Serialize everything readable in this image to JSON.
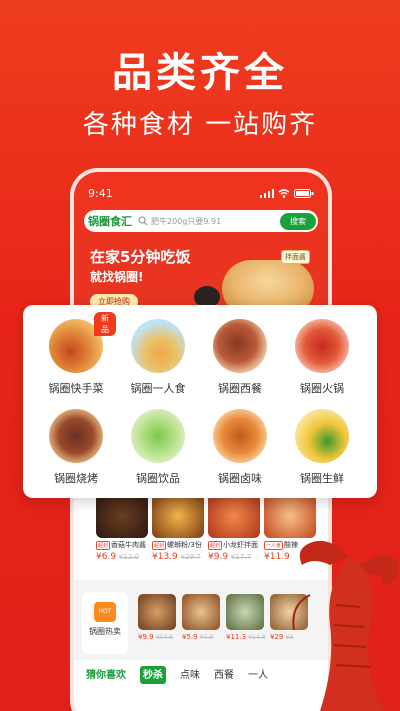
{
  "headline": "品类齐全",
  "subline": "各种食材 一站购齐",
  "phone": {
    "time": "9:41",
    "logo": "锅圈食汇",
    "search_placeholder": "肥牛200g只要9.91",
    "search_button": "搜索",
    "banner": {
      "title": "在家5分钟吃饭",
      "subtitle": "就找锅圈!",
      "button": "立即抢购",
      "tag": "拌面酱"
    },
    "products": [
      {
        "tag": "超划",
        "name": "香菇牛肉酱",
        "price": "¥6.9",
        "old": "¥12.0"
      },
      {
        "tag": "超划",
        "name": "螺蛳粉/3份",
        "price": "¥13.9",
        "old": "¥29.7"
      },
      {
        "tag": "超划",
        "name": "小龙虾拌面",
        "price": "¥9.9",
        "old": "¥17.7"
      },
      {
        "tag": "一人食",
        "name": "酸辣",
        "price": "¥11.9",
        "old": ""
      }
    ],
    "hot": {
      "label": "锅圈热卖",
      "icon_text": "HOT"
    },
    "mini_products": [
      {
        "price": "¥9.9",
        "old": "¥14.6"
      },
      {
        "price": "¥5.9",
        "old": "¥7.9"
      },
      {
        "price": "¥11.3",
        "old": "¥14.8"
      },
      {
        "price": "¥29",
        "old": "¥3"
      }
    ],
    "tabs": [
      "猜你喜欢",
      "秒杀",
      "点味",
      "西餐",
      "一人"
    ]
  },
  "categories": [
    {
      "label": "锅圈快手菜",
      "badge": "新品",
      "colors": [
        "#f6c26a",
        "#c9461c"
      ]
    },
    {
      "label": "锅圈一人食",
      "colors": [
        "#bfe3f7",
        "#f2a64a"
      ]
    },
    {
      "label": "锅圈西餐",
      "colors": [
        "#f4cfa8",
        "#8a3820"
      ]
    },
    {
      "label": "锅圈火锅",
      "colors": [
        "#f7c4b0",
        "#c8271e"
      ]
    },
    {
      "label": "锅圈烧烤",
      "colors": [
        "#f1c38a",
        "#6b2f22"
      ]
    },
    {
      "label": "锅圈饮品",
      "colors": [
        "#dff1c8",
        "#7cc84a"
      ]
    },
    {
      "label": "锅圈卤味",
      "colors": [
        "#fbd7a2",
        "#c25a1a"
      ]
    },
    {
      "label": "锅圈生鲜",
      "colors": [
        "#fbe9a6",
        "#3e9a2e"
      ]
    }
  ]
}
